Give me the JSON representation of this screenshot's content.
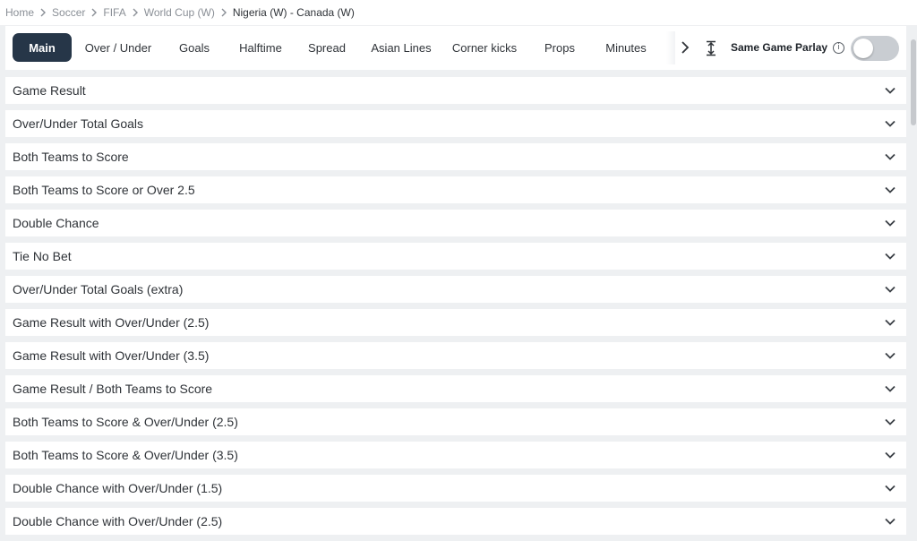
{
  "breadcrumb": {
    "items": [
      "Home",
      "Soccer",
      "FIFA",
      "World Cup (W)"
    ],
    "current": "Nigeria (W) - Canada (W)"
  },
  "tabs": {
    "items": [
      "Main",
      "Over / Under",
      "Goals",
      "Halftime",
      "Spread",
      "Asian Lines",
      "Corner kicks",
      "Props",
      "Minutes"
    ],
    "active": "Main",
    "more_icon": "chevron-right-icon",
    "expand_icon": "expand-vertical-icon"
  },
  "parlay": {
    "label": "Same Game Parlay",
    "info_icon": "info-icon",
    "enabled": false
  },
  "markets": [
    "Game Result",
    "Over/Under Total Goals",
    "Both Teams to Score",
    "Both Teams to Score or Over 2.5",
    "Double Chance",
    "Tie No Bet",
    "Over/Under Total Goals (extra)",
    "Game Result with Over/Under (2.5)",
    "Game Result with Over/Under (3.5)",
    "Game Result / Both Teams to Score",
    "Both Teams to Score & Over/Under (2.5)",
    "Both Teams to Score & Over/Under (3.5)",
    "Double Chance with Over/Under (1.5)",
    "Double Chance with Over/Under (2.5)"
  ],
  "colors": {
    "active_tab": "#263648",
    "page_bg": "#eef0f2",
    "toggle_off": "#c9cdd2"
  }
}
